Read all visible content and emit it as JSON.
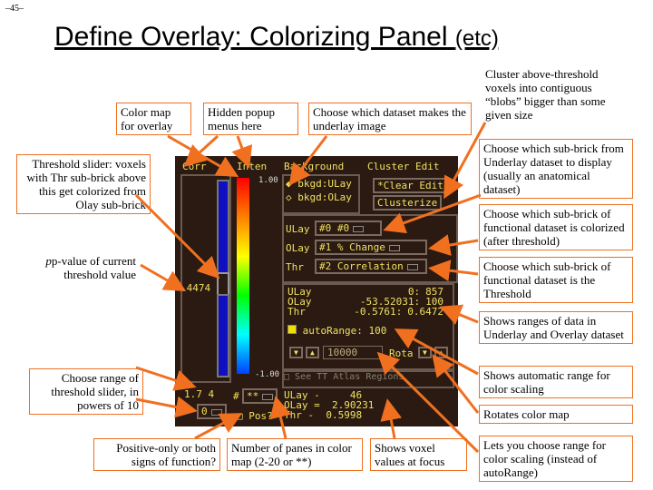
{
  "page_number": "–45–",
  "title": {
    "main": "Define Overlay: Colorizing Panel",
    "suffix": "(etc)"
  },
  "notes": {
    "color_map": "Color map for overlay",
    "hidden_popup": "Hidden popup menus here",
    "choose_dataset": "Choose which dataset makes the underlay image",
    "cluster": "Cluster above-threshold voxels into contiguous “blobs” bigger than some given size",
    "threshold_slider": "Threshold slider: voxels with Thr sub-brick above this get colorized from Olay sub-brick",
    "p_value": "p-value of current threshold value",
    "underlay_subbrick": "Choose which sub-brick from Underlay dataset to display (usually an anatomical dataset)",
    "functional_subbrick": "Choose which sub-brick of functional dataset is colorized (after threshold)",
    "threshold_subbrick": "Choose which sub-brick of functional dataset is the Threshold",
    "ranges": "Shows ranges of data in Underlay and Overlay dataset",
    "auto_range": "Shows automatic range for color scaling",
    "rotate": "Rotates color map",
    "range_threshold": "Choose range of threshold slider, in powers of 10",
    "positive_only": "Positive-only or both signs of function?",
    "num_panes": "Number of panes in color map (2-20 or **)",
    "voxel_values": "Shows voxel values at focus",
    "choose_range": "Lets you choose range for color scaling (instead of autoRange)"
  },
  "panel": {
    "corr": "Corr",
    "inten": "Inten",
    "background": "Background",
    "cluster_edit": "Cluster Edit",
    "cmap_top": "1.00",
    "cmap_bottom": "-1.00",
    "bkgd_ulay": "bkgd:ULay",
    "bkgd_olay": "bkgd:OLay",
    "clear_edit": "*Clear Edit",
    "clusterize": "Clusterize",
    "ulay_label": "ULay",
    "ulay_value": "#0 #0",
    "olay_label": "OLay",
    "olay_value": "#1 % Change",
    "thr_label": "Thr",
    "thr_value": "#2 Correlation",
    "p_value": ".4474",
    "range_rows": [
      [
        "ULay",
        "0:",
        "857"
      ],
      [
        "OLay",
        "-53.52031:",
        "100"
      ],
      [
        "Thr",
        "-0.5761:",
        "0.6472"
      ]
    ],
    "auto_range": "autoRange: 100",
    "range_input": "10000",
    "rota": "Rota",
    "exponent": "1.7 4",
    "power": "**",
    "power_value": "0",
    "panes_hash": "#",
    "panes_value": "**",
    "pos": "Pos?",
    "see_atlas": "See TT Atlas Regions",
    "voxel_rows": [
      [
        "ULay",
        "-",
        "46"
      ],
      [
        "OLay",
        "=",
        "2.90231"
      ],
      [
        "Thr",
        "-",
        "0.5998"
      ]
    ]
  },
  "colors": {
    "arrow": "#f07020",
    "panel_bg": "#2a1a12",
    "panel_text": "#f0e060"
  }
}
